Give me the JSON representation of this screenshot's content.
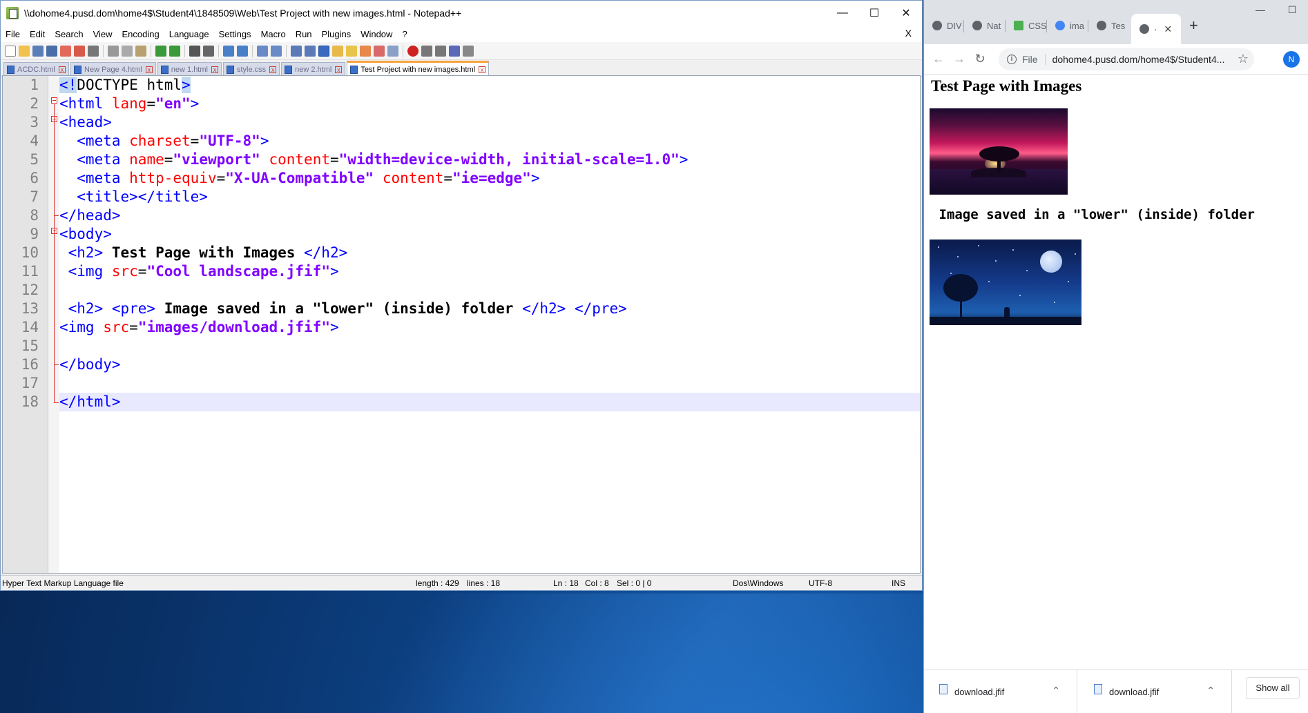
{
  "notepad": {
    "title": "\\\\dohome4.pusd.dom\\home4$\\Student4\\1848509\\Web\\Test Project with new images.html - Notepad++",
    "menu": [
      "File",
      "Edit",
      "Search",
      "View",
      "Encoding",
      "Language",
      "Settings",
      "Macro",
      "Run",
      "Plugins",
      "Window",
      "?"
    ],
    "menu_close": "X",
    "tabs": [
      {
        "label": "ACDC.html",
        "active": false
      },
      {
        "label": "New Page 4.html",
        "active": false
      },
      {
        "label": "new 1.html",
        "active": false
      },
      {
        "label": "style.css",
        "active": false
      },
      {
        "label": "new 2.html",
        "active": false
      },
      {
        "label": "Test Project with new images.html",
        "active": true
      }
    ],
    "line_numbers": [
      "1",
      "2",
      "3",
      "4",
      "5",
      "6",
      "7",
      "8",
      "9",
      "10",
      "11",
      "12",
      "13",
      "14",
      "15",
      "16",
      "17",
      "18"
    ],
    "code": {
      "l1_a": "<!",
      "l1_b": "DOCTYPE html",
      "l1_c": ">",
      "l2_tag": "<html ",
      "l2_attr": "lang",
      "l2_eq": "=",
      "l2_val": "\"en\"",
      "l2_close": ">",
      "l3": "<head>",
      "l4_tag": "  <meta ",
      "l4_attr": "charset",
      "l4_eq": "=",
      "l4_val": "\"UTF-8\"",
      "l4_close": ">",
      "l5_tag": "  <meta ",
      "l5_attr1": "name",
      "l5_eq1": "=",
      "l5_val1": "\"viewport\"",
      "l5_sp": " ",
      "l5_attr2": "content",
      "l5_eq2": "=",
      "l5_val2": "\"width=device-width, initial-scale=1.0\"",
      "l5_close": ">",
      "l6_tag": "  <meta ",
      "l6_attr1": "http-equiv",
      "l6_eq1": "=",
      "l6_val1": "\"X-UA-Compatible\"",
      "l6_sp": " ",
      "l6_attr2": "content",
      "l6_eq2": "=",
      "l6_val2": "\"ie=edge\"",
      "l6_close": ">",
      "l7": "  <title></title>",
      "l8": "</head>",
      "l9": "<body>",
      "l10_open": " <h2>",
      "l10_text": " Test Page with Images ",
      "l10_close": "</h2>",
      "l11_tag": " <img ",
      "l11_attr": "src",
      "l11_eq": "=",
      "l11_val": "\"Cool landscape.jfif\"",
      "l11_close": ">",
      "l13_open": " <h2> <pre>",
      "l13_text": " Image saved in a \"lower\" (inside) folder ",
      "l13_close": "</h2> </pre>",
      "l14_tag": "<img ",
      "l14_attr": "src",
      "l14_eq": "=",
      "l14_val": "\"images/download.jfif\"",
      "l14_close": ">",
      "l16": "</body>",
      "l18": "</html>"
    },
    "status": {
      "file_type": "Hyper Text Markup Language file",
      "length": "length : 429",
      "lines": "lines : 18",
      "ln": "Ln : 18",
      "col": "Col : 8",
      "sel": "Sel : 0 | 0",
      "eol": "Dos\\Windows",
      "encoding": "UTF-8",
      "mode": "INS"
    }
  },
  "chrome": {
    "tabs": [
      "DIV",
      "Nat",
      "CSS",
      "ima",
      "Tes",
      "·"
    ],
    "newtab": "+",
    "scheme": "File",
    "url": "dohome4.pusd.dom/home4$/Student4...",
    "profile_initial": "N",
    "page": {
      "heading": "Test Page with Images",
      "pre_text": " Image saved in a \"lower\" (inside) folder"
    },
    "downloads": [
      {
        "name": "download.jfif"
      },
      {
        "name": "download.jfif"
      }
    ],
    "show_all": "Show all"
  }
}
